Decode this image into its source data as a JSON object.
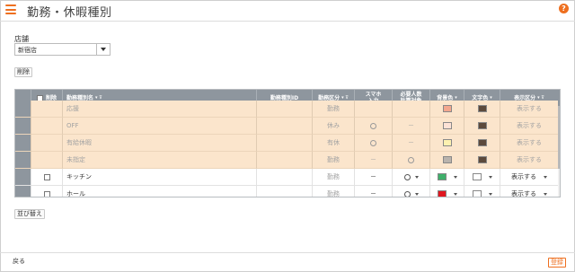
{
  "header": {
    "title": "勤務・休暇種別",
    "help_symbol": "?"
  },
  "store": {
    "label": "店舗",
    "selected": "新宿店"
  },
  "buttons": {
    "delete": "削除",
    "sort": "並び替え",
    "back": "戻る",
    "register": "登録"
  },
  "table": {
    "columns": {
      "delete": "削除",
      "name": "勤務種別名",
      "id": "勤務種別ID",
      "category": "勤務区分",
      "smartphone_l1": "スマホ",
      "smartphone_l2": "入力",
      "required_l1": "必要人数",
      "required_l2": "計算対象",
      "bgcolor": "背景色",
      "textcolor": "文字色",
      "display": "表示区分"
    },
    "rows": [
      {
        "style": "peach",
        "check": false,
        "name": "応援",
        "category": "勤務",
        "smartphone": "circle",
        "required": "",
        "bg_color": "#f3a78f",
        "text_color": "#5c4a3c",
        "display": "表示する"
      },
      {
        "style": "peach",
        "check": false,
        "name": "OFF",
        "category": "休み",
        "smartphone": "circle",
        "required": "－",
        "bg_color": "#fde2d6",
        "text_color": "#5c4a3c",
        "display": "表示する"
      },
      {
        "style": "peach",
        "check": false,
        "name": "有給休暇",
        "category": "有休",
        "smartphone": "circle",
        "required": "－",
        "bg_color": "#fdf1b0",
        "text_color": "#5c4a3c",
        "display": "表示する"
      },
      {
        "style": "peach",
        "check": false,
        "name": "未指定",
        "category": "勤務",
        "smartphone": "－",
        "required": "circle",
        "bg_color": "#b9b3ad",
        "text_color": "#5c4a3c",
        "display": "表示する"
      },
      {
        "style": "white",
        "check": true,
        "name": "キッチン",
        "category": "勤務",
        "smartphone": "－",
        "required": "circle",
        "bg_color": "#3fb06b",
        "text_color": "#ffffff",
        "display": "表示する"
      },
      {
        "style": "white",
        "check": true,
        "name": "ホール",
        "category": "勤務",
        "smartphone": "－",
        "required": "circle",
        "bg_color": "#e0161f",
        "text_color": "#ffffff",
        "display": "表示する"
      }
    ]
  },
  "colors": {
    "accent": "#ee6f1f",
    "header_bg": "#8e969e",
    "row_peach": "#fbe5cc"
  }
}
